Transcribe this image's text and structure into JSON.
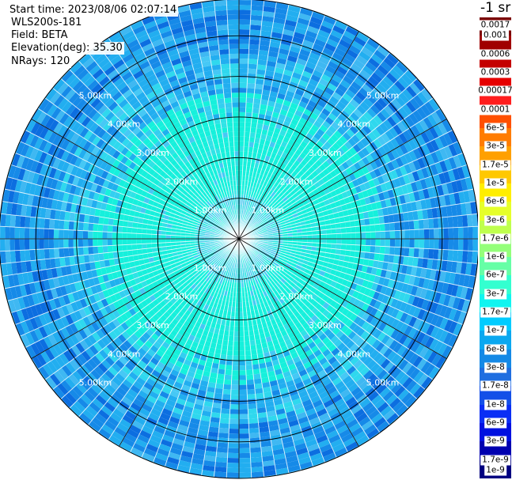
{
  "info": {
    "start_time": "Start time: 2023/08/06 02:07:14",
    "device": "WLS200s-181",
    "field": "Field: BETA",
    "elevation": "Elevation(deg): 35.30",
    "nrays": "NRays: 120"
  },
  "colorbar": {
    "unit_title": "-1 sr",
    "labels": [
      "0.0017",
      "0.001",
      "0.0006",
      "0.0003",
      "0.00017",
      "0.0001",
      "6e-5",
      "3e-5",
      "1.7e-5",
      "1e-5",
      "6e-6",
      "3e-6",
      "1.7e-6",
      "1e-6",
      "6e-7",
      "3e-7",
      "1.7e-7",
      "1e-7",
      "6e-8",
      "3e-8",
      "1.7e-8",
      "1e-8",
      "6e-9",
      "3e-9",
      "1.7e-9",
      "1e-9"
    ],
    "colors": [
      "#7a0000",
      "#a00000",
      "#c40000",
      "#e60000",
      "#ff1e1e",
      "#ff5000",
      "#ff7c00",
      "#ffa000",
      "#ffc800",
      "#ffee00",
      "#e6ff2a",
      "#bfff4d",
      "#94ff7a",
      "#66ffa6",
      "#33ffd0",
      "#10f5f0",
      "#00ccff",
      "#0aa8f0",
      "#1489e6",
      "#1f6ee0",
      "#1450e8",
      "#0a2ef5",
      "#0010e0",
      "#0000b0",
      "#000080"
    ]
  },
  "chart_data": {
    "type": "heatmap",
    "projection": "polar-ppi",
    "field": "BETA",
    "elevation_deg": 35.3,
    "nrays": 120,
    "range_rings_km": [
      1,
      2,
      3,
      4,
      5
    ],
    "ring_labels": [
      "1.00km",
      "2.00km",
      "3.00km",
      "4.00km",
      "5.00km"
    ],
    "max_range_km": 5.9,
    "spokes_deg": [
      0,
      30,
      60,
      90,
      120,
      150,
      180,
      210,
      240,
      270,
      300,
      330
    ],
    "range_band_dominant_beta": [
      {
        "range_km": [
          0,
          1
        ],
        "beta": "3e-7"
      },
      {
        "range_km": [
          1,
          3
        ],
        "beta": "1.7e-7"
      },
      {
        "range_km": [
          3,
          4
        ],
        "beta": "1e-7"
      },
      {
        "range_km": [
          4,
          5.9
        ],
        "beta": "6e-8"
      }
    ],
    "colorscale": "log",
    "color_range": [
      "1e-9",
      "0.0017"
    ]
  }
}
